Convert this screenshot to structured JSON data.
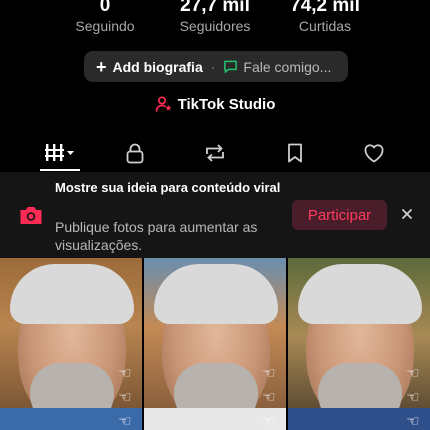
{
  "profile": {
    "stats": [
      {
        "value": "0",
        "label": "Seguindo"
      },
      {
        "value": "27,7 mil",
        "label": "Seguidores"
      },
      {
        "value": "74,2 mil",
        "label": "Curtidas"
      }
    ]
  },
  "actions": {
    "add_bio_label": "Add biografia",
    "separator": "·",
    "contact_label": "Fale comigo..."
  },
  "studio": {
    "label": "TikTok Studio",
    "accent_color": "#fe2c55"
  },
  "tabs": [
    {
      "icon": "grid-icon",
      "active": true
    },
    {
      "icon": "lock-icon"
    },
    {
      "icon": "repost-icon"
    },
    {
      "icon": "bookmark-icon"
    },
    {
      "icon": "heart-icon"
    }
  ],
  "banner": {
    "title": "Mostre sua ideia para conteúdo viral",
    "description": "Publique fotos para aumentar as visualizações.",
    "join_label": "Participar",
    "close_glyph": "×"
  },
  "videos": [
    {
      "thumbnail": "portrait-thumbnail"
    },
    {
      "thumbnail": "portrait-thumbnail"
    },
    {
      "thumbnail": "portrait-thumbnail"
    }
  ]
}
